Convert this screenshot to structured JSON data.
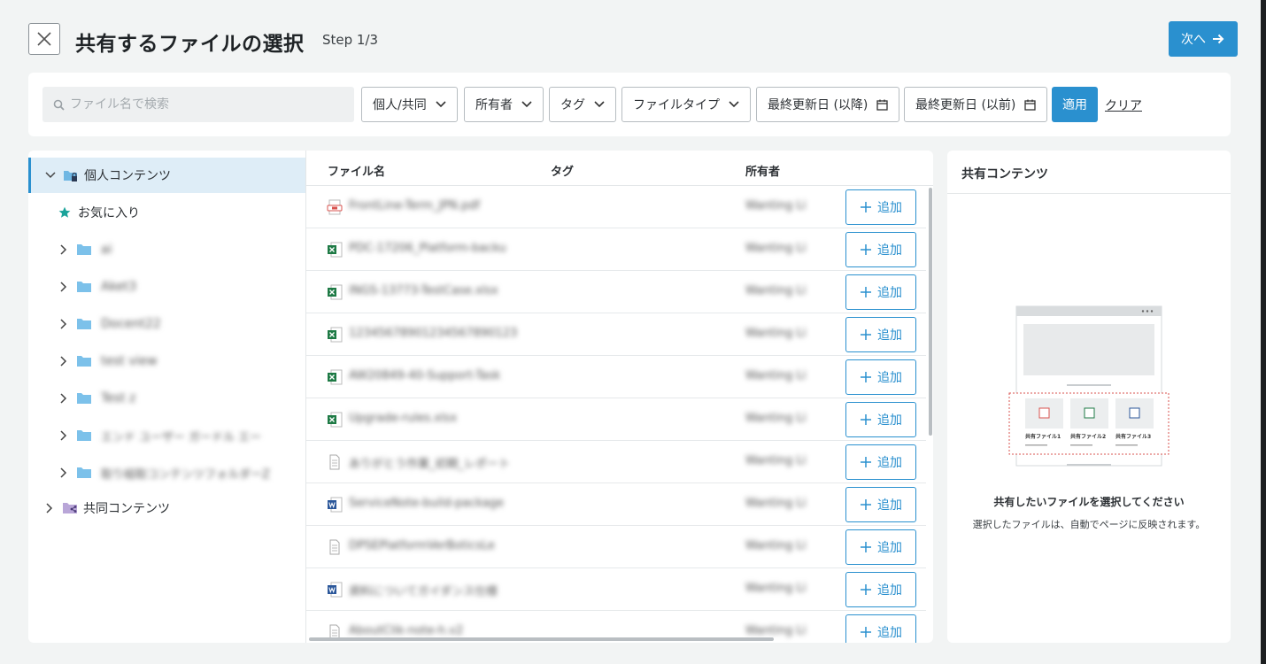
{
  "header": {
    "title": "共有するファイルの選択",
    "step": "Step 1/3",
    "next_label": "次へ"
  },
  "filters": {
    "search_placeholder": "ファイル名で検索",
    "dropdowns": [
      "個人/共同",
      "所有者",
      "タグ",
      "ファイルタイプ"
    ],
    "date_after": "最終更新日 (以降)",
    "date_before": "最終更新日 (以前)",
    "apply_label": "適用",
    "clear_label": "クリア"
  },
  "tree": {
    "personal": "個人コンテンツ",
    "favorites": "お気に入り",
    "folders": [
      "ai",
      "Aket3",
      "Docent22",
      "test view",
      "Test z",
      "エンド ユーザー ガードル エー",
      "取り組取コンテンツフォルダーZ"
    ],
    "shared": "共同コンテンツ"
  },
  "files": {
    "columns": {
      "name": "ファイル名",
      "tag": "タグ",
      "owner": "所有者"
    },
    "add_label": "追加",
    "rows": [
      {
        "type": "pdf",
        "name": "FrontLine-Term_JPN.pdf",
        "owner": "Wanting Li"
      },
      {
        "type": "excel",
        "name": "PDC-17206_Platform-backu",
        "owner": "Wanting Li"
      },
      {
        "type": "excel",
        "name": "INGS-13773-TestCase.xlsx",
        "owner": "Wanting Li"
      },
      {
        "type": "excel",
        "name": "12345678901234567890123",
        "owner": "Wanting Li"
      },
      {
        "type": "excel",
        "name": "AW20849-40-Support-Task",
        "owner": "Wanting Li"
      },
      {
        "type": "excel",
        "name": "Upgrade-rules.xlsx",
        "owner": "Wanting Li"
      },
      {
        "type": "doc",
        "name": "ありがとう作業_初期_レポート",
        "owner": "Wanting Li"
      },
      {
        "type": "word",
        "name": "ServiceNote-build-package",
        "owner": "Wanting Li"
      },
      {
        "type": "doc",
        "name": "DPSEPlatformVerBoticsLe",
        "owner": "Wanting Li"
      },
      {
        "type": "word",
        "name": "資料についてガイダンス仕様",
        "owner": "Wanting Li"
      },
      {
        "type": "doc",
        "name": "AboutClik-note-h.v2",
        "owner": "Wanting Li"
      }
    ]
  },
  "shared_panel": {
    "title": "共有コンテンツ",
    "empty_title": "共有したいファイルを選択してください",
    "empty_desc": "選択したファイルは、自動でページに反映されます。",
    "illustration_labels": [
      "共有ファイル1",
      "共有ファイル2",
      "共有ファイル3"
    ]
  }
}
